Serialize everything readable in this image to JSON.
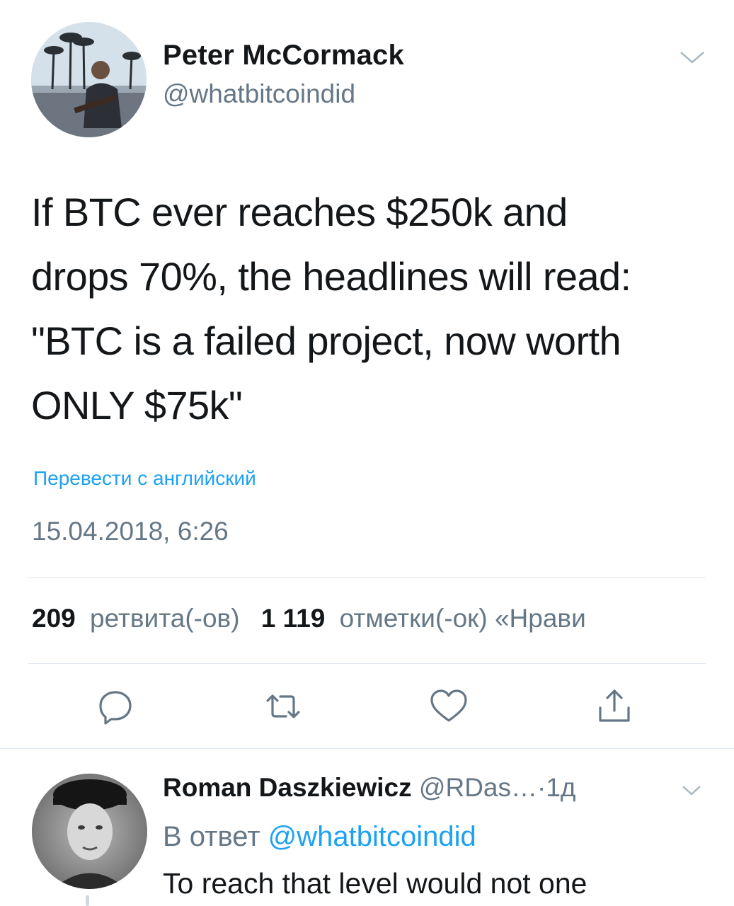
{
  "tweet": {
    "author": {
      "name": "Peter McCormack",
      "handle": "@whatbitcoindid"
    },
    "text_lines": [
      "If BTC ever reaches $250k and",
      "drops 70%, the headlines will read:",
      "\"BTC is a failed project, now worth",
      "ONLY $75k\""
    ],
    "translate_link": "Перевести с английский",
    "timestamp": "15.04.2018, 6:26",
    "stats": {
      "retweets_count": "209",
      "retweets_label": "ретвита(-ов)",
      "likes_count": "1 119",
      "likes_label": "отметки(-ок) «Нрави"
    },
    "actions": [
      "reply-icon",
      "retweet-icon",
      "heart-icon",
      "share-icon"
    ]
  },
  "reply": {
    "author": {
      "name": "Roman Daszkiewicz",
      "handle": "@RDas…"
    },
    "separator": "·",
    "time": "1д",
    "reply_to_prefix": "В ответ",
    "reply_to_handle": "@whatbitcoindid",
    "text": "To reach that level would not one"
  },
  "colors": {
    "accent": "#1da1f2",
    "secondary_text": "#657786",
    "primary_text": "#14171a",
    "divider": "#e1e8ed"
  }
}
